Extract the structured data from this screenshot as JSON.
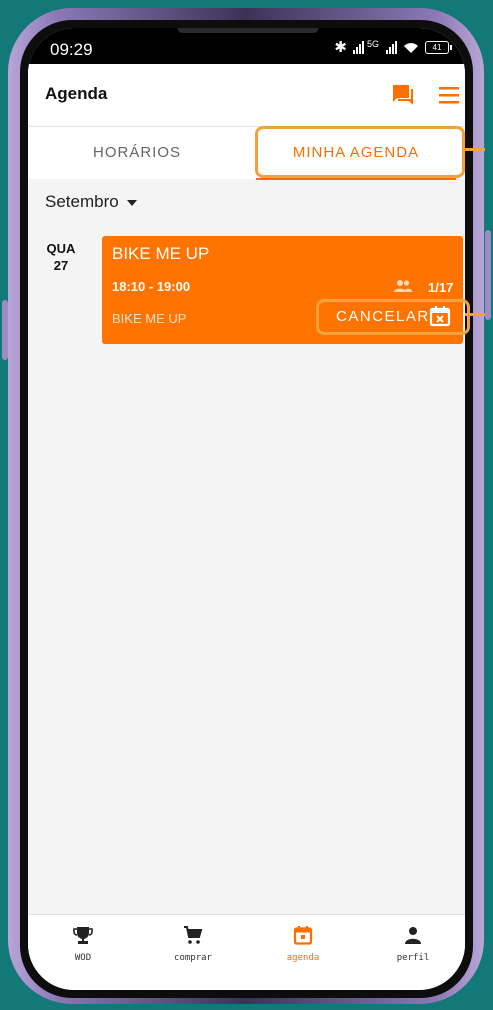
{
  "status_bar": {
    "time": "09:29",
    "network": "5G",
    "battery": "41"
  },
  "header": {
    "title": "Agenda",
    "chat_icon": "chat-icon",
    "menu_icon": "menu-icon"
  },
  "tabs": [
    {
      "label": "HORÁRIOS",
      "active": false
    },
    {
      "label": "MINHA AGENDA",
      "active": true
    }
  ],
  "month": {
    "label": "Setembro"
  },
  "events": [
    {
      "weekday": "QUA",
      "day": "27",
      "title": "BIKE ME UP",
      "time": "18:10 - 19:00",
      "occupancy": "1/17",
      "subtitle": "BIKE ME UP",
      "cancel_label": "CANCELAR"
    }
  ],
  "bottom_nav": [
    {
      "label": "WOD",
      "icon": "trophy-icon"
    },
    {
      "label": "comprar",
      "icon": "cart-icon"
    },
    {
      "label": "agenda",
      "icon": "calendar-icon",
      "active": true
    },
    {
      "label": "perfil",
      "icon": "person-icon"
    }
  ],
  "colors": {
    "accent": "#ff6f00",
    "card": "#ff7300",
    "highlight": "#f0a33b",
    "background": "#127878"
  }
}
